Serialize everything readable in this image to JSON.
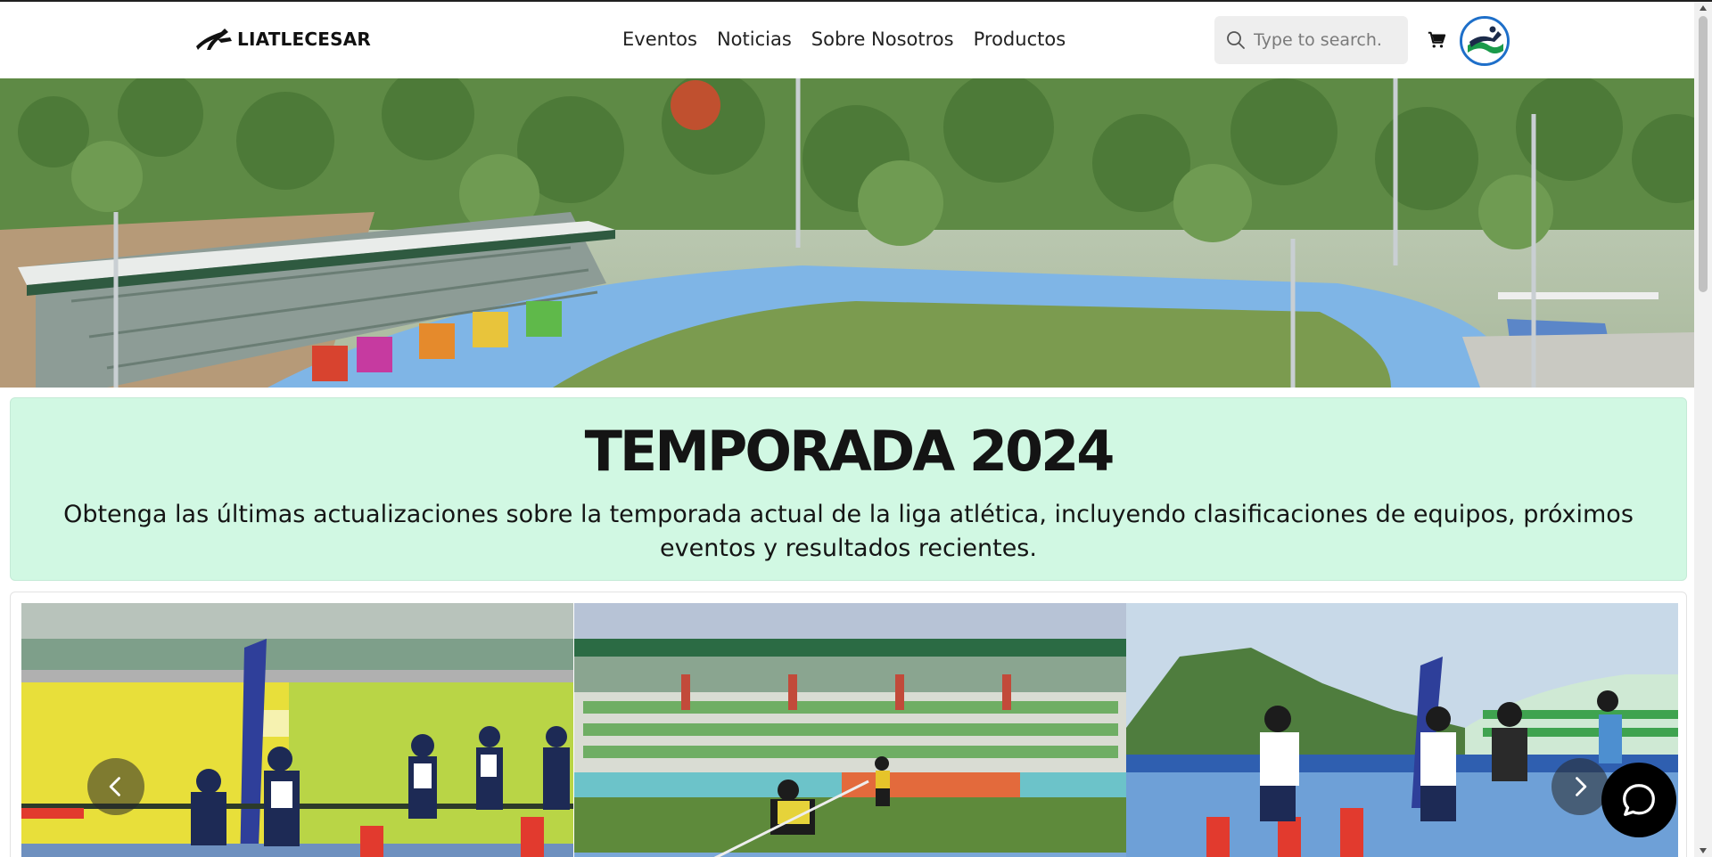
{
  "brand": {
    "name": "LIATLECESAR"
  },
  "nav": {
    "links": [
      {
        "label": "Eventos"
      },
      {
        "label": "Noticias"
      },
      {
        "label": "Sobre Nosotros"
      },
      {
        "label": "Productos"
      }
    ]
  },
  "search": {
    "placeholder": "Type to search."
  },
  "icons": {
    "search": "search-icon",
    "cart": "cart-icon",
    "avatar": "avatar",
    "prev": "chevron-left-icon",
    "next": "chevron-right-icon",
    "chat": "chat-icon"
  },
  "season": {
    "title": "TEMPORADA 2024",
    "description": "Obtenga las últimas actualizaciones sobre la temporada actual de la liga atlética, incluyendo clasificaciones de equipos, próximos eventos y resultados recientes."
  },
  "colors": {
    "season_bg": "#d1f8e3",
    "avatar_border": "#1e6fc9",
    "track_blue": "#7fb5e6"
  }
}
